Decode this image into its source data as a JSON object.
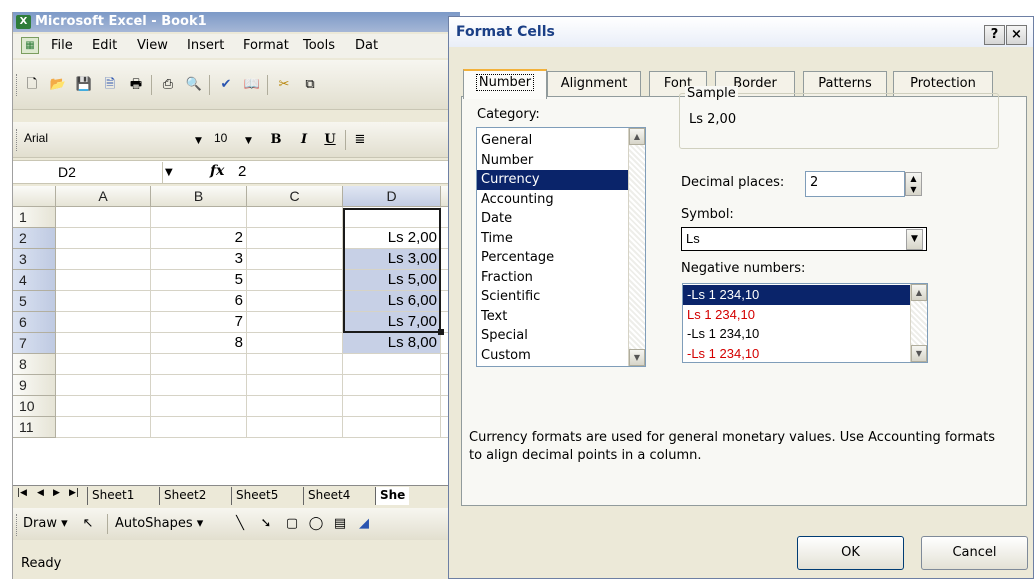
{
  "excel": {
    "title": "Microsoft Excel - Book1",
    "menu": [
      "File",
      "Edit",
      "View",
      "Insert",
      "Format",
      "Tools",
      "Dat"
    ],
    "font_name": "Arial",
    "font_size": "10",
    "bold": "B",
    "italic": "I",
    "underline": "U",
    "name_box": "D2",
    "fx_label": "fx",
    "formula_value": "2",
    "columns": [
      "A",
      "B",
      "C",
      "D"
    ],
    "rows": [
      "1",
      "2",
      "3",
      "4",
      "5",
      "6",
      "7",
      "8",
      "9",
      "10",
      "11"
    ],
    "column_b": [
      "",
      "2",
      "3",
      "5",
      "6",
      "7",
      "8",
      "",
      "",
      "",
      ""
    ],
    "column_d": [
      "",
      "Ls 2,00",
      "Ls 3,00",
      "Ls 5,00",
      "Ls 6,00",
      "Ls 7,00",
      "Ls 8,00",
      "",
      "",
      "",
      ""
    ],
    "sheet_tabs": [
      "Sheet1",
      "Sheet2",
      "Sheet5",
      "Sheet4",
      "She"
    ],
    "draw_label": "Draw",
    "autoshapes_label": "AutoShapes",
    "status": "Ready"
  },
  "dialog": {
    "title": "Format Cells",
    "help_btn": "?",
    "close_btn": "×",
    "tabs": [
      "Number",
      "Alignment",
      "Font",
      "Border",
      "Patterns",
      "Protection"
    ],
    "category_label": "Category:",
    "categories": [
      "General",
      "Number",
      "Currency",
      "Accounting",
      "Date",
      "Time",
      "Percentage",
      "Fraction",
      "Scientific",
      "Text",
      "Special",
      "Custom"
    ],
    "selected_category": "Currency",
    "sample_label": "Sample",
    "sample_value": "Ls 2,00",
    "decimal_label": "Decimal places:",
    "decimal_value": "2",
    "symbol_label": "Symbol:",
    "symbol_value": "Ls",
    "negative_label": "Negative numbers:",
    "negative_options": [
      "-Ls 1 234,10",
      "Ls 1 234,10",
      "-Ls 1 234,10",
      "-Ls 1 234,10"
    ],
    "description": "Currency formats are used for general monetary values.  Use Accounting formats to align decimal points in a column.",
    "ok_label": "OK",
    "cancel_label": "Cancel"
  }
}
